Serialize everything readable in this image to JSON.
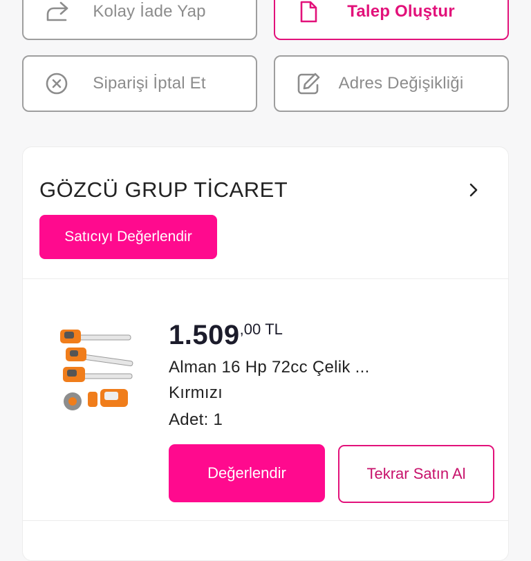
{
  "actions": {
    "easy_return": "Kolay İade Yap",
    "create_request": "Talep Oluştur",
    "cancel_order": "Siparişi İptal Et",
    "address_change": "Adres Değişikliği"
  },
  "seller": {
    "name": "GÖZCÜ GRUP TİCARET",
    "rate_button": "Satıcıyı Değerlendir"
  },
  "product": {
    "price_int": "1.509",
    "price_dec": ",00",
    "currency": "TL",
    "title": "Alman 16 Hp 72cc Çelik ...",
    "variant": "Kırmızı",
    "quantity": "Adet: 1"
  },
  "buttons": {
    "review": "Değerlendir",
    "rebuy": "Tekrar Satın Al"
  },
  "colors": {
    "accent": "#ff0a8e",
    "accent_border": "#e2117a",
    "muted_text": "#8c8c8c"
  },
  "icons": {
    "easy_return": "share-arrow-icon",
    "create_request": "document-icon",
    "cancel_order": "close-circle-icon",
    "address_change": "edit-icon",
    "seller_link": "chevron-right-icon"
  }
}
